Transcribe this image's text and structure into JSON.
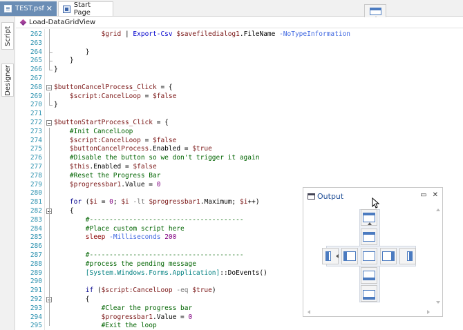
{
  "tabs": [
    {
      "label": "TEST.psf",
      "close": "✕",
      "active": true
    },
    {
      "label": "Start Page",
      "active": false
    }
  ],
  "side_tabs": {
    "script": "Script",
    "designer": "Designer"
  },
  "function_dropdown": {
    "selected": "Load-DataGridView"
  },
  "output_panel": {
    "title": "Output",
    "pin_label": "▭",
    "close_label": "✕"
  },
  "colors": {
    "active_tab": "#6a8db5",
    "line_number": "#2b91af",
    "comment": "#006400",
    "variable": "#7a1515",
    "keyword": "#00008b",
    "cmdlet": "#0000cd",
    "parameter": "#4169e1",
    "number": "#800080",
    "output_title": "#1f4e96"
  },
  "code": {
    "lines": [
      {
        "n": "262",
        "tokens": [
          [
            "",
            "            "
          ],
          [
            "var",
            "$grid"
          ],
          [
            "",
            " | "
          ],
          [
            "cmd",
            "Export-Csv"
          ],
          [
            "",
            " "
          ],
          [
            "var",
            "$savefiledialog1"
          ],
          [
            "",
            ".FileName "
          ],
          [
            "par",
            "-NoTypeInformation"
          ]
        ]
      },
      {
        "n": "263",
        "tokens": []
      },
      {
        "n": "264",
        "tokens": [
          [
            "",
            "        }"
          ]
        ]
      },
      {
        "n": "265",
        "tokens": [
          [
            "",
            "    }"
          ]
        ]
      },
      {
        "n": "266",
        "tokens": [
          [
            "",
            "}"
          ]
        ]
      },
      {
        "n": "267",
        "tokens": []
      },
      {
        "n": "268",
        "tokens": [
          [
            "var",
            "$buttonCancelProcess_Click"
          ],
          [
            "",
            " = {"
          ]
        ]
      },
      {
        "n": "269",
        "tokens": [
          [
            "",
            "    "
          ],
          [
            "var",
            "$script:CancelLoop"
          ],
          [
            "",
            " = "
          ],
          [
            "var",
            "$false"
          ]
        ]
      },
      {
        "n": "270",
        "tokens": [
          [
            "",
            "}"
          ]
        ]
      },
      {
        "n": "271",
        "tokens": []
      },
      {
        "n": "272",
        "tokens": [
          [
            "var",
            "$buttonStartProcess_Click"
          ],
          [
            "",
            " = {"
          ]
        ]
      },
      {
        "n": "273",
        "tokens": [
          [
            "",
            "    "
          ],
          [
            "com",
            "#Init CancelLoop"
          ]
        ]
      },
      {
        "n": "274",
        "tokens": [
          [
            "",
            "    "
          ],
          [
            "var",
            "$script:CancelLoop"
          ],
          [
            "",
            " = "
          ],
          [
            "var",
            "$false"
          ]
        ]
      },
      {
        "n": "275",
        "tokens": [
          [
            "",
            "    "
          ],
          [
            "var",
            "$buttonCancelProcess"
          ],
          [
            "",
            ".Enabled = "
          ],
          [
            "var",
            "$true"
          ]
        ]
      },
      {
        "n": "276",
        "tokens": [
          [
            "",
            "    "
          ],
          [
            "com",
            "#Disable the button so we don't trigger it again"
          ]
        ]
      },
      {
        "n": "277",
        "tokens": [
          [
            "",
            "    "
          ],
          [
            "var",
            "$this"
          ],
          [
            "",
            ".Enabled = "
          ],
          [
            "var",
            "$false"
          ]
        ]
      },
      {
        "n": "278",
        "tokens": [
          [
            "",
            "    "
          ],
          [
            "com",
            "#Reset the Progress Bar"
          ]
        ]
      },
      {
        "n": "279",
        "tokens": [
          [
            "",
            "    "
          ],
          [
            "var",
            "$progressbar1"
          ],
          [
            "",
            ".Value = "
          ],
          [
            "num",
            "0"
          ]
        ]
      },
      {
        "n": "280",
        "tokens": []
      },
      {
        "n": "281",
        "tokens": [
          [
            "",
            "    "
          ],
          [
            "kw",
            "for"
          ],
          [
            "",
            " ("
          ],
          [
            "var",
            "$i"
          ],
          [
            "",
            " = "
          ],
          [
            "num",
            "0"
          ],
          [
            "",
            "; "
          ],
          [
            "var",
            "$i"
          ],
          [
            "",
            " "
          ],
          [
            "op",
            "-lt"
          ],
          [
            "",
            " "
          ],
          [
            "var",
            "$progressbar1"
          ],
          [
            "",
            ".Maximum; "
          ],
          [
            "var",
            "$i"
          ],
          [
            "",
            "++)"
          ]
        ]
      },
      {
        "n": "282",
        "tokens": [
          [
            "",
            "    {"
          ]
        ]
      },
      {
        "n": "283",
        "tokens": [
          [
            "",
            "        "
          ],
          [
            "com",
            "#---------------------------------------"
          ]
        ]
      },
      {
        "n": "284",
        "tokens": [
          [
            "",
            "        "
          ],
          [
            "com",
            "#Place custom script here"
          ]
        ]
      },
      {
        "n": "285",
        "tokens": [
          [
            "",
            "        "
          ],
          [
            "str",
            "sleep"
          ],
          [
            "",
            " "
          ],
          [
            "par",
            "-Milliseconds"
          ],
          [
            "",
            " "
          ],
          [
            "num",
            "200"
          ]
        ]
      },
      {
        "n": "286",
        "tokens": []
      },
      {
        "n": "287",
        "tokens": [
          [
            "",
            "        "
          ],
          [
            "com",
            "#---------------------------------------"
          ]
        ]
      },
      {
        "n": "288",
        "tokens": [
          [
            "",
            "        "
          ],
          [
            "com",
            "#process the pending message"
          ]
        ]
      },
      {
        "n": "289",
        "tokens": [
          [
            "",
            "        "
          ],
          [
            "type",
            "[System.Windows.Forms.Application]"
          ],
          [
            "",
            "::DoEvents()"
          ]
        ]
      },
      {
        "n": "290",
        "tokens": []
      },
      {
        "n": "291",
        "tokens": [
          [
            "",
            "        "
          ],
          [
            "kw",
            "if"
          ],
          [
            "",
            " ("
          ],
          [
            "var",
            "$script:CancelLoop"
          ],
          [
            "",
            " "
          ],
          [
            "op",
            "-eq"
          ],
          [
            "",
            " "
          ],
          [
            "var",
            "$true"
          ],
          [
            "",
            ")"
          ]
        ]
      },
      {
        "n": "292",
        "tokens": [
          [
            "",
            "        {"
          ]
        ]
      },
      {
        "n": "293",
        "tokens": [
          [
            "",
            "            "
          ],
          [
            "com",
            "#Clear the progress bar"
          ]
        ]
      },
      {
        "n": "294",
        "tokens": [
          [
            "",
            "            "
          ],
          [
            "var",
            "$progressbar1"
          ],
          [
            "",
            ".Value = "
          ],
          [
            "num",
            "0"
          ]
        ]
      },
      {
        "n": "295",
        "tokens": [
          [
            "",
            "            "
          ],
          [
            "com",
            "#Exit the loop"
          ]
        ]
      }
    ]
  }
}
